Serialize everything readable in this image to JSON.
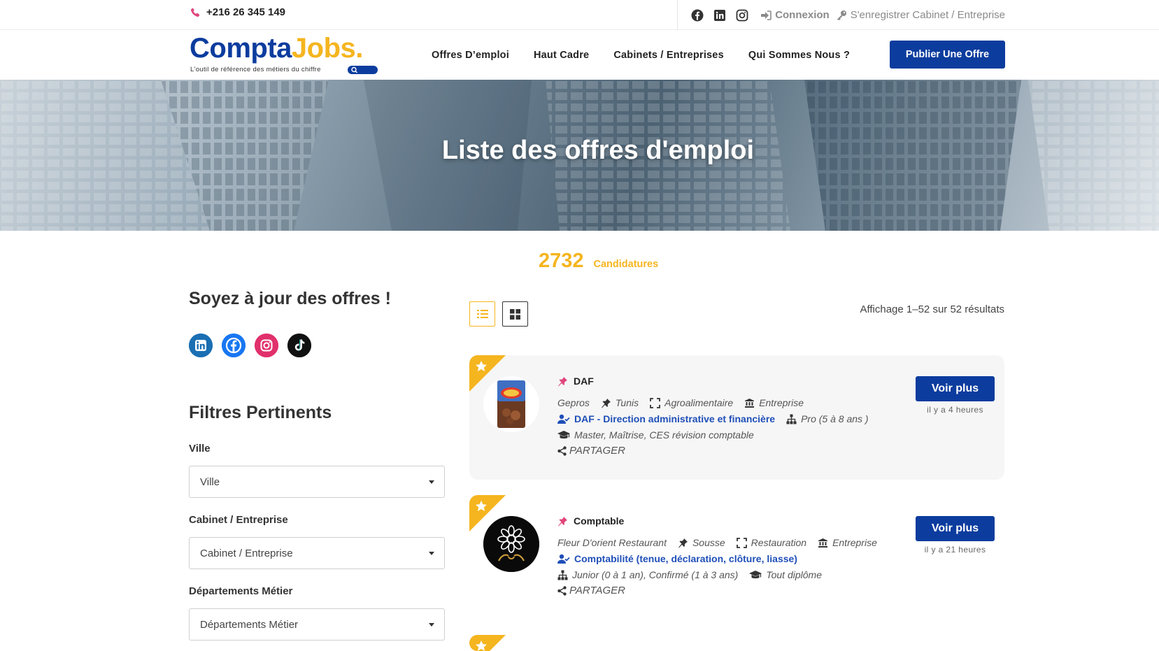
{
  "topbar": {
    "phone": "+216 26 345 149",
    "social_icons": [
      "facebook-icon",
      "linkedin-icon",
      "instagram-icon"
    ],
    "login_label": "Connexion",
    "register_label": "S'enregistrer Cabinet / Entreprise"
  },
  "header": {
    "logo_part1": "Compta",
    "logo_part2": "Jobs.",
    "logo_tagline": "L'outil de référence des métiers du chiffre",
    "nav": [
      "Offres D’emploi",
      "Haut Cadre",
      "Cabinets / Entreprises",
      "Qui Sommes Nous ?"
    ],
    "publish_label": "Publier Une Offre"
  },
  "hero": {
    "title": "Liste des offres d'emploi"
  },
  "counter": {
    "value": "2732",
    "label": "Candidatures"
  },
  "sidebar": {
    "follow_title": "Soyez à jour des offres !",
    "social": [
      "linkedin-icon",
      "facebook-icon",
      "instagram-icon",
      "tiktok-icon"
    ],
    "filters_title": "Filtres Pertinents",
    "filters": [
      {
        "label": "Ville",
        "placeholder": "Ville"
      },
      {
        "label": "Cabinet / Entreprise",
        "placeholder": "Cabinet / Entreprise"
      },
      {
        "label": "Départements Métier",
        "placeholder": "Départements Métier"
      }
    ]
  },
  "results": {
    "summary": "Affichage 1–52 sur 52 résultats",
    "jobs": [
      {
        "title": "DAF",
        "company": "Gepros",
        "city": "Tunis",
        "sector": "Agroalimentaire",
        "type": "Entreprise",
        "department": "DAF - Direction administrative et financière",
        "level": "Pro (5 à 8 ans )",
        "diploma": "Master, Maîtrise, CES révision comptable",
        "share": "PARTAGER",
        "button": "Voir plus",
        "posted": "il y a 4 heures"
      },
      {
        "title": "Comptable",
        "company": "Fleur D'orient Restaurant",
        "city": "Sousse",
        "sector": "Restauration",
        "type": "Entreprise",
        "department": "Comptabilité (tenue, déclaration, clôture, liasse)",
        "level": "Junior (0 à 1 an), Confirmé (1 à 3 ans)",
        "diploma": "Tout diplôme",
        "share": "PARTAGER",
        "button": "Voir plus",
        "posted": "il y a 21 heures"
      }
    ]
  },
  "colors": {
    "brand_blue": "#0c3c9e",
    "accent_yellow": "#f5b51f",
    "link_blue": "#1f4fb8"
  }
}
